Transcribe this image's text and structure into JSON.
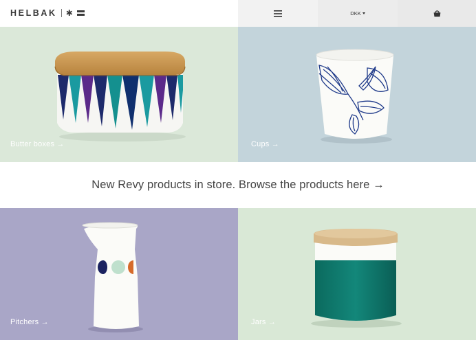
{
  "header": {
    "logo_text": "HELBAK",
    "currency": "DKK",
    "menu_icon": "hamburger-icon",
    "cart_icon": "shopping-bag-icon"
  },
  "tiles": [
    {
      "label": "Butter boxes →",
      "color": "#dbe8d9"
    },
    {
      "label": "Cups →",
      "color": "#c3d4db"
    },
    {
      "label": "Pitchers →",
      "color": "#a9a6c7"
    },
    {
      "label": "Jars →",
      "color": "#d9e8d6"
    }
  ],
  "banner": {
    "text": "New Revy products in store. Browse the products here →"
  }
}
